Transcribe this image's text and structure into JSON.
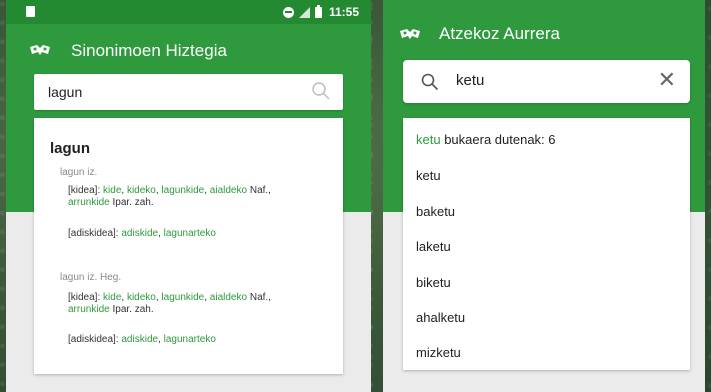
{
  "screen1": {
    "status": {
      "time": "11:55"
    },
    "app_title": "Sinonimoen Hiztegia",
    "search_value": "lagun",
    "entry": {
      "headword": "lagun",
      "senses": [
        {
          "pos": "lagun iz.",
          "groups": [
            {
              "label": "[kidea]: ",
              "words": [
                "kide",
                "kideko",
                "lagunkide",
                "aialdeko"
              ],
              "tail": " Naf.,",
              "words2": [
                "arrunkide"
              ],
              "tail2": " Ipar. zah."
            },
            {
              "label": "[adiskidea]: ",
              "words": [
                "adiskide",
                "lagunarteko"
              ]
            }
          ]
        },
        {
          "pos": "lagun iz. Heg.",
          "groups": [
            {
              "label": "[kidea]: ",
              "words": [
                "kide",
                "kideko",
                "lagunkide",
                "aialdeko"
              ],
              "tail": " Naf.,",
              "words2": [
                "arrunkide"
              ],
              "tail2": " Ipar. zah."
            },
            {
              "label": "[adiskidea]: ",
              "words": [
                "adiskide",
                "lagunarteko"
              ]
            }
          ]
        }
      ]
    }
  },
  "screen2": {
    "app_title": "Atzekoz Aurrera",
    "search_value": "ketu",
    "results_header": {
      "highlight": "ketu",
      "rest": " bukaera dutenak: 6"
    },
    "results": [
      "ketu",
      "baketu",
      "laketu",
      "biketu",
      "ahalketu",
      "mizketu"
    ]
  },
  "colors": {
    "accent": "#2e9a3d",
    "status_bar": "#238a31"
  },
  "icons": [
    "logo-icon",
    "search-icon",
    "close-icon",
    "dnd-icon",
    "signal-icon",
    "battery-icon"
  ]
}
